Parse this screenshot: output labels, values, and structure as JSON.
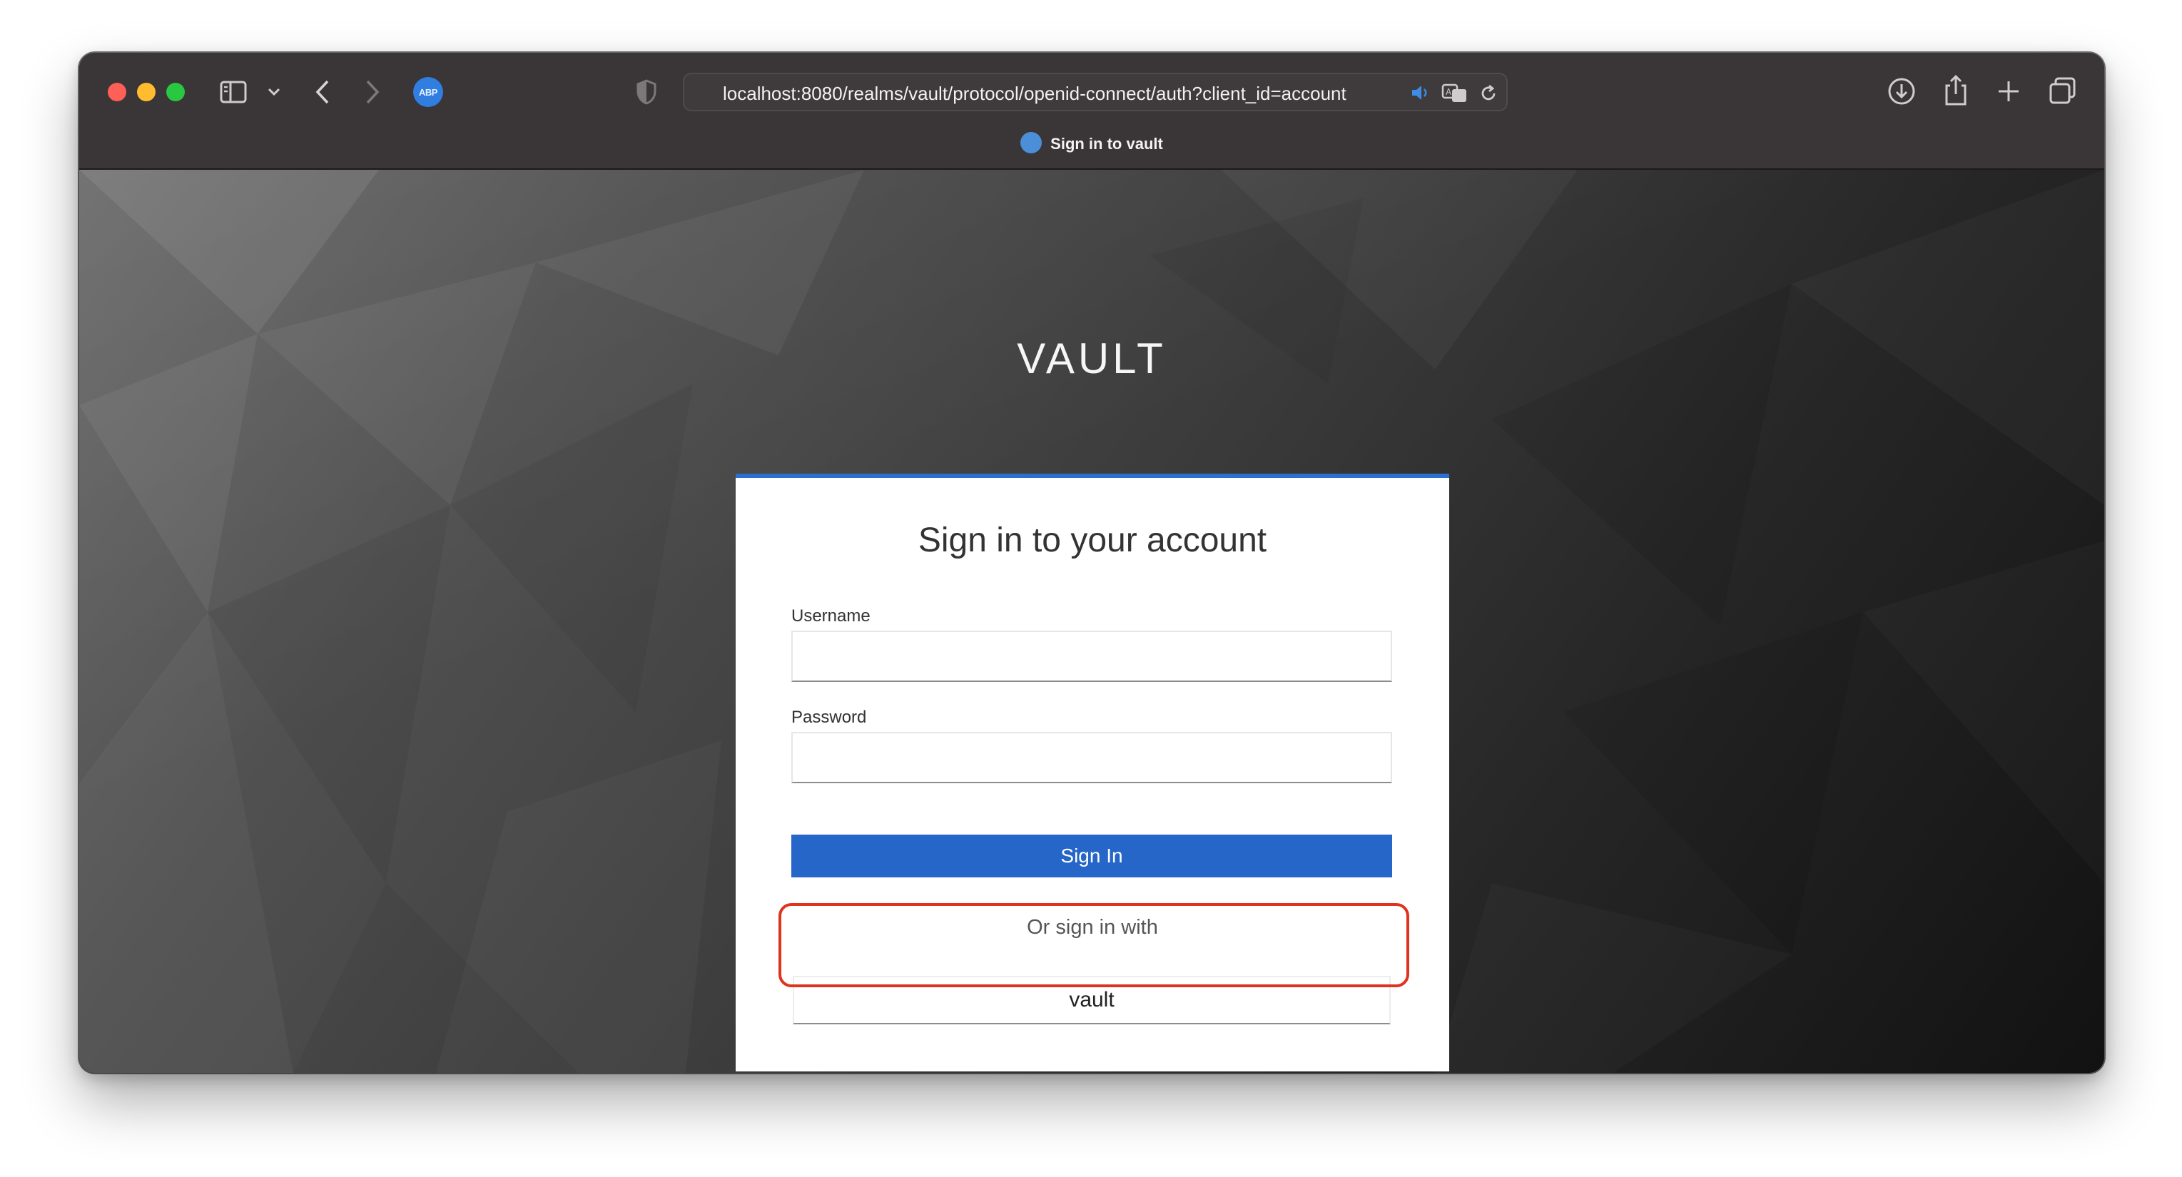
{
  "browser": {
    "url": "localhost:8080/realms/vault/protocol/openid-connect/auth?client_id=account",
    "tab_title": "Sign in to vault",
    "extension_label": "ABP"
  },
  "page": {
    "brand": "VAULT",
    "card_title": "Sign in to your account",
    "username_label": "Username",
    "username_value": "",
    "password_label": "Password",
    "password_value": "",
    "signin_label": "Sign In",
    "alt_signin_text": "Or sign in with",
    "providers": [
      "vault"
    ]
  },
  "colors": {
    "accent": "#2566c8",
    "highlight": "#e0331f"
  }
}
